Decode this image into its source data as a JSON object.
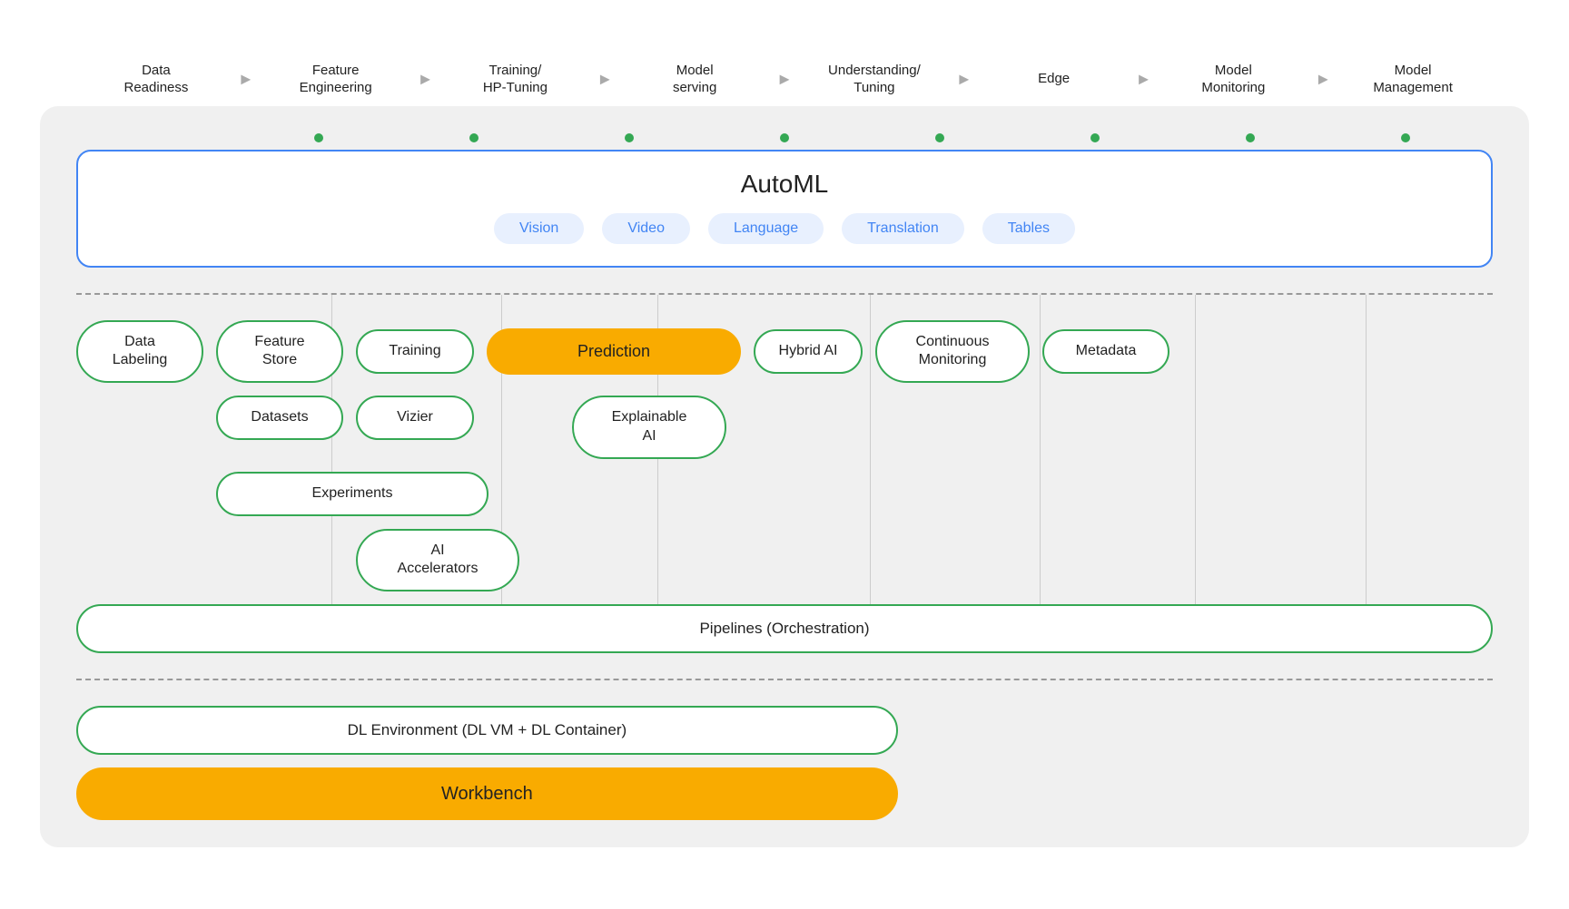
{
  "pipeline": {
    "steps": [
      {
        "label": "Data\nReadiness"
      },
      {
        "label": "Feature\nEngineering"
      },
      {
        "label": "Training/\nHP-Tuning"
      },
      {
        "label": "Model\nserving"
      },
      {
        "label": "Understanding/\nTuning"
      },
      {
        "label": "Edge"
      },
      {
        "label": "Model\nMonitoring"
      },
      {
        "label": "Model\nManagement"
      }
    ]
  },
  "automl": {
    "title": "AutoML",
    "chips": [
      "Vision",
      "Video",
      "Language",
      "Translation",
      "Tables"
    ]
  },
  "vertex": {
    "row1": {
      "col1": {
        "label": "Data\nLabeling"
      },
      "col2": {
        "label": "Feature\nStore"
      },
      "col3": {
        "label": "Training"
      },
      "col4": {
        "label": "Prediction",
        "highlighted": true
      },
      "col5": {
        "label": "Hybrid AI"
      },
      "col6": {
        "label": "Continuous\nMonitoring"
      },
      "col7": {
        "label": "Metadata"
      }
    },
    "row2": {
      "col1": {
        "label": "Datasets"
      },
      "col2": {
        "label": "Vizier"
      },
      "col3": {
        "label": "Explainable\nAI"
      }
    },
    "row3": {
      "col1": {
        "label": "Experiments"
      }
    },
    "row4": {
      "col1": {
        "label": "AI\nAccelerators"
      }
    }
  },
  "pipelines": {
    "label": "Pipelines (Orchestration)"
  },
  "bottom": {
    "dl_env": "DL Environment (DL VM + DL Container)",
    "workbench": "Workbench"
  },
  "dots": [
    false,
    true,
    true,
    true,
    true,
    true,
    true,
    true,
    true
  ]
}
